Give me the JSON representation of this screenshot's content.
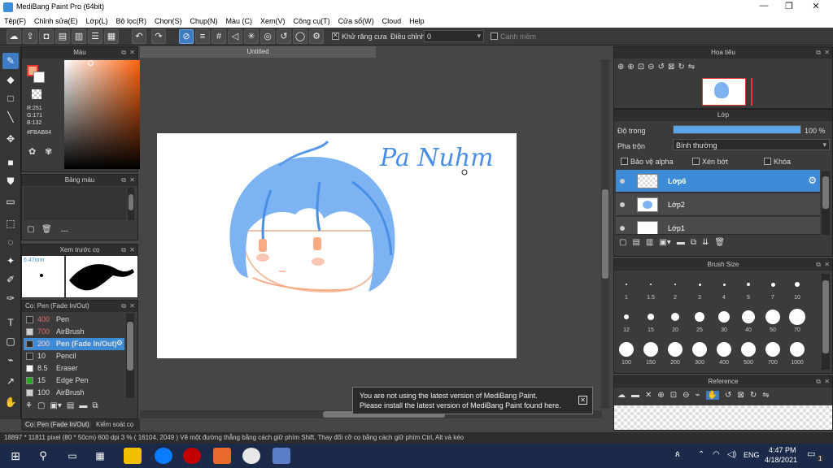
{
  "window": {
    "title": "MediBang Paint Pro (64bit)",
    "minimize": "—",
    "restore": "❐",
    "close": "✕"
  },
  "menu": [
    "Tệp(F)",
    "Chỉnh sửa(E)",
    "Lớp(L)",
    "Bộ lọc(R)",
    "Chọn(S)",
    "Chụp(N)",
    "Màu (C)",
    "Xem(V)",
    "Công cụ(T)",
    "Cửa sổ(W)",
    "Cloud",
    "Help"
  ],
  "toolbar": {
    "antialias_label": "Khử răng cưa",
    "adjust_label": "Điều chỉnh",
    "adjust_value": "0",
    "canh_mem_label": "Cạnh mềm"
  },
  "color_panel": {
    "title": "Màu",
    "r": "R:251",
    "g": "G:171",
    "b": "B:132",
    "hex": "#FBAB84",
    "main_color": "#fbab84"
  },
  "palette_panel": {
    "title": "Bảng màu",
    "entry": "---"
  },
  "brush_preview": {
    "title": "Xem trước cọ",
    "size": "6.47mm"
  },
  "brush_list": {
    "title": "Cọ: Pen (Fade In/Out)",
    "items": [
      {
        "size": "400",
        "name": "Pen",
        "swatch": "#2b2b2b"
      },
      {
        "size": "700",
        "name": "AirBrush",
        "swatch": "#cfcfcf"
      },
      {
        "size": "200",
        "name": "Pen (Fade In/Out)",
        "swatch": "#2b2b2b"
      },
      {
        "size": "10",
        "name": "Pencil",
        "swatch": "#2b2b2b"
      },
      {
        "size": "8.5",
        "name": "Eraser",
        "swatch": "#ffffff"
      },
      {
        "size": "15",
        "name": "Edge Pen",
        "swatch": "#22aa22"
      },
      {
        "size": "100",
        "name": "AirBrush",
        "swatch": "#cfcfcf"
      }
    ],
    "footer_tab1": "Cọ: Pen (Fade In/Out)",
    "footer_tab2": "Kiểm soát cọ"
  },
  "document": {
    "tab": "Untitled",
    "signature": "Pa Nuhm"
  },
  "notice": {
    "line1": "You are not using the latest version of MediBang Paint.",
    "line2": "Please install the latest version of MediBang Paint found here."
  },
  "navigator": {
    "title": "Hoa tiêu"
  },
  "layers": {
    "title": "Lớp",
    "opacity_label": "Độ trong",
    "opacity_value": "100 %",
    "opacity_fraction": 1.0,
    "blend_label": "Pha trộn",
    "blend_value": "Bình thường",
    "protect_alpha": "Bảo vệ alpha",
    "clipping": "Xén bớt",
    "lock": "Khóa",
    "items": [
      {
        "name": "Lớp6",
        "selected": true
      },
      {
        "name": "Lớp2",
        "selected": false
      },
      {
        "name": "Lớp1",
        "selected": false
      }
    ]
  },
  "brush_size": {
    "title": "Brush Size",
    "sizes": [
      "1",
      "1.5",
      "2",
      "3",
      "4",
      "5",
      "7",
      "10",
      "12",
      "15",
      "20",
      "25",
      "30",
      "40",
      "50",
      "70",
      "100",
      "150",
      "200",
      "300",
      "400",
      "500",
      "700",
      "1000"
    ]
  },
  "reference": {
    "title": "Reference"
  },
  "status": {
    "text": "18897 * 11811 pixel  (80 * 50cm)  600 dpi  3 %  ( 16104, 2049 )  Vẽ một đường thẳng bằng cách giữ phím Shift, Thay đổi cỡ cọ bằng cách giữ phím Ctrl, Alt và kéo"
  },
  "taskbar": {
    "time": "4:47 PM",
    "date": "4/18/2021",
    "lang": "ENG",
    "notif": "1"
  }
}
